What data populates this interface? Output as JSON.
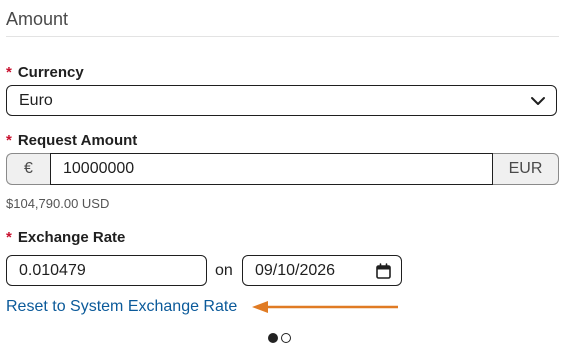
{
  "section": {
    "title": "Amount"
  },
  "currency": {
    "label": "Currency",
    "value": "Euro",
    "required_mark": "*"
  },
  "request_amount": {
    "label": "Request Amount",
    "required_mark": "*",
    "prefix": "€",
    "value": "10000000",
    "suffix": "EUR",
    "converted_note": "$104,790.00 USD"
  },
  "exchange_rate": {
    "label": "Exchange Rate",
    "required_mark": "*",
    "value": "0.010479",
    "on_label": "on",
    "date": "09/10/2026"
  },
  "reset_link": {
    "label": "Reset to System Exchange Rate"
  },
  "annotation": {
    "arrow_color": "#e07b24"
  },
  "pager": {
    "pages": 2,
    "active": 1
  },
  "colors": {
    "required": "#c8102e",
    "link": "#0b5a9a"
  },
  "icons": {
    "select": "chevron-down-icon",
    "date": "calendar-icon",
    "annotation": "arrow-left-icon"
  }
}
